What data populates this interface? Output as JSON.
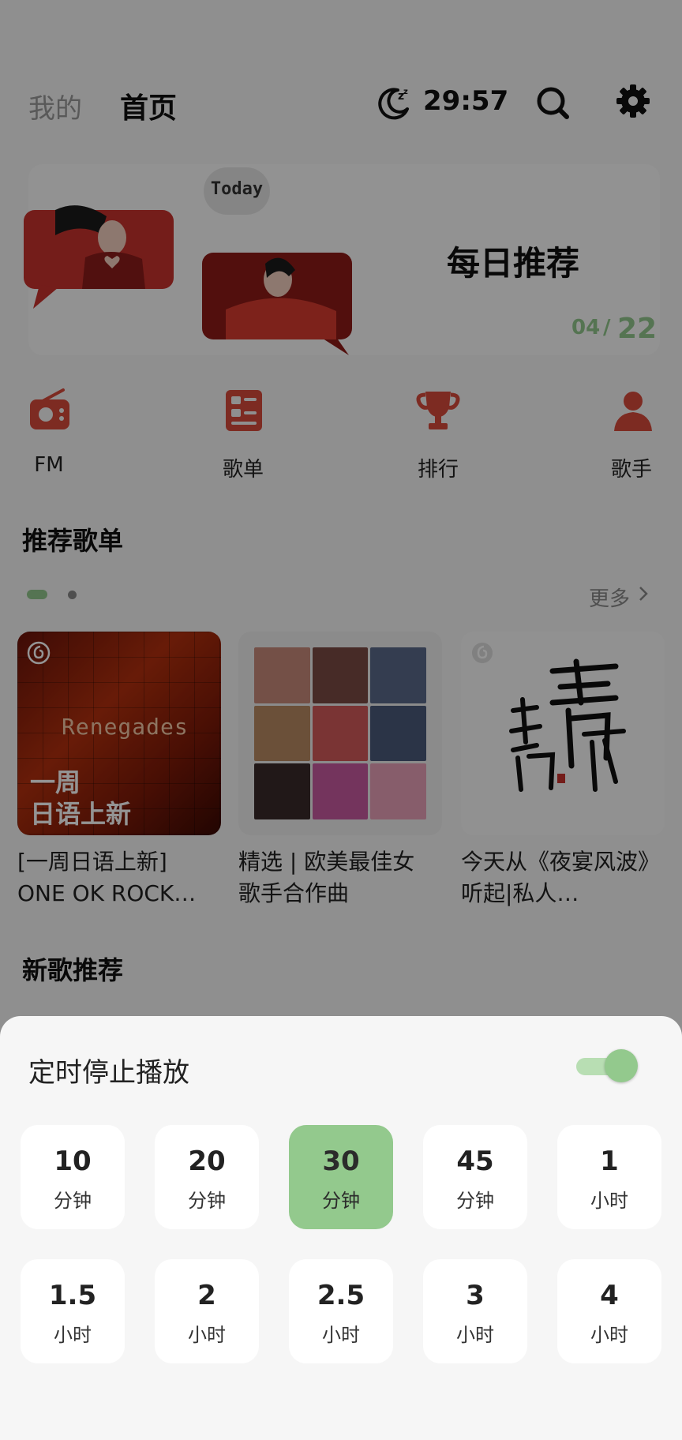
{
  "header": {
    "tab_mine": "我的",
    "tab_home": "首页",
    "sleep_timer_remaining": "29:57"
  },
  "banner": {
    "today_label": "Today",
    "title": "每日推荐",
    "month": "04",
    "slash": "/",
    "day": "22"
  },
  "categories": [
    {
      "label": "FM",
      "icon": "radio-icon"
    },
    {
      "label": "歌单",
      "icon": "playlist-icon"
    },
    {
      "label": "排行",
      "icon": "trophy-icon"
    },
    {
      "label": "歌手",
      "icon": "singer-icon"
    }
  ],
  "recommended_playlists": {
    "title": "推荐歌单",
    "more_label": "更多",
    "items": [
      {
        "name": "[一周日语上新] ONE OK ROCK…",
        "cover_text_band": "Renegades",
        "cover_text_1": "一周",
        "cover_text_2": "日语上新"
      },
      {
        "name": "精选 | 欧美最佳女歌手合作曲"
      },
      {
        "name": "今天从《夜宴风波》听起|私人…"
      }
    ]
  },
  "new_songs": {
    "title": "新歌推荐"
  },
  "sleep_timer_sheet": {
    "title": "定时停止播放",
    "enabled": true,
    "accent_color": "#93c98d",
    "options": [
      {
        "value": "10",
        "unit": "分钟",
        "selected": false
      },
      {
        "value": "20",
        "unit": "分钟",
        "selected": false
      },
      {
        "value": "30",
        "unit": "分钟",
        "selected": true
      },
      {
        "value": "45",
        "unit": "分钟",
        "selected": false
      },
      {
        "value": "1",
        "unit": "小时",
        "selected": false
      },
      {
        "value": "1.5",
        "unit": "小时",
        "selected": false
      },
      {
        "value": "2",
        "unit": "小时",
        "selected": false
      },
      {
        "value": "2.5",
        "unit": "小时",
        "selected": false
      },
      {
        "value": "3",
        "unit": "小时",
        "selected": false
      },
      {
        "value": "4",
        "unit": "小时",
        "selected": false
      }
    ]
  }
}
